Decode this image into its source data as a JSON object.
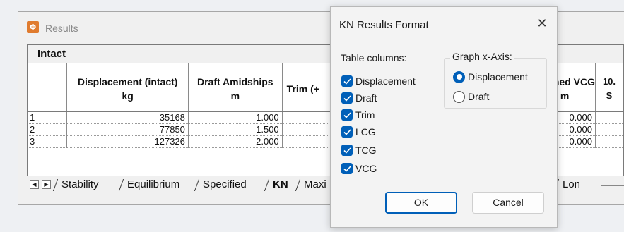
{
  "results_window": {
    "title": "Results",
    "icon": "app-logo-icon",
    "sheet_title": "Intact",
    "table": {
      "columns": [
        {
          "line1": "",
          "line2": ""
        },
        {
          "line1": "Displacement (intact)",
          "line2": "kg"
        },
        {
          "line1": "Draft Amidships",
          "line2": "m"
        },
        {
          "line1": "Trim (+",
          "line2": ""
        },
        {
          "line1": "ned VCG",
          "line2": "m"
        },
        {
          "line1": "10.",
          "line2": "S"
        }
      ],
      "rows": [
        {
          "num": "1",
          "displacement": "35168",
          "draft": "1.000",
          "vcg": "0.000"
        },
        {
          "num": "2",
          "displacement": "77850",
          "draft": "1.500",
          "vcg": "0.000"
        },
        {
          "num": "3",
          "displacement": "127326",
          "draft": "2.000",
          "vcg": "0.000"
        }
      ]
    },
    "tabs": [
      "Stability",
      "Equilibrium",
      "Specified",
      "KN",
      "Maxi",
      "Lon"
    ],
    "active_tab": "KN",
    "nav_left": "◀",
    "nav_right": "▶"
  },
  "dialog": {
    "title": "KN Results Format",
    "close_glyph": "✕",
    "table_columns_label": "Table columns:",
    "checkboxes": [
      {
        "label": "Displacement",
        "checked": true
      },
      {
        "label": "Draft",
        "checked": true
      },
      {
        "label": "Trim",
        "checked": true
      },
      {
        "label": "LCG",
        "checked": true
      },
      {
        "label": "TCG",
        "checked": true
      },
      {
        "label": "VCG",
        "checked": true
      }
    ],
    "graph_x_axis_label": "Graph x-Axis:",
    "radios": [
      {
        "label": "Displacement",
        "selected": true
      },
      {
        "label": "Draft",
        "selected": false
      }
    ],
    "ok_label": "OK",
    "cancel_label": "Cancel",
    "accent_color": "#005fb8"
  }
}
